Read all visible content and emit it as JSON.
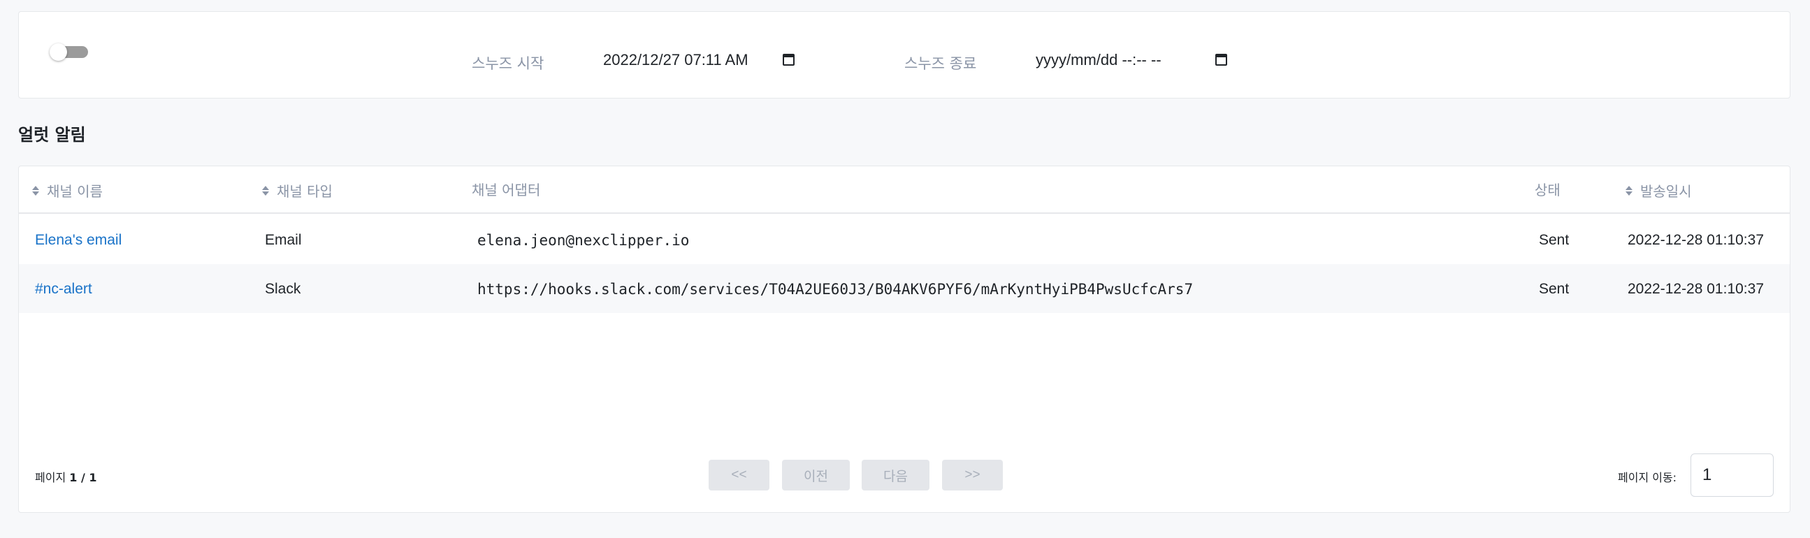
{
  "snooze": {
    "toggle_on": false,
    "start_label": "스누즈 시작",
    "start_value": "2022/12/27 07:11 AM",
    "end_label": "스누즈 종료",
    "end_value": "yyyy/mm/dd --:-- --"
  },
  "section": {
    "title": "얼럿 알림"
  },
  "table": {
    "headers": {
      "channel_name": "채널 이름",
      "channel_type": "채널 타입",
      "channel_adapter": "채널 어댑터",
      "status": "상태",
      "sent_at": "발송일시"
    },
    "rows": [
      {
        "name": "Elena's email",
        "type": "Email",
        "adapter": "elena.jeon@nexclipper.io",
        "status": "Sent",
        "sent_at": "2022-12-28 01:10:37"
      },
      {
        "name": "#nc-alert",
        "type": "Slack",
        "adapter": "https://hooks.slack.com/services/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",
        "status": "Sent",
        "sent_at": "2022-12-28 01:10:37"
      }
    ]
  },
  "pagination": {
    "page_label": "페이지",
    "page_value": "1 / 1",
    "first": "<<",
    "prev": "이전",
    "next": "다음",
    "last": ">>",
    "goto_label": "페이지 이동:",
    "goto_value": "1"
  },
  "colors": {
    "link": "#1a73c8",
    "muted": "#8a94a6",
    "toggle_track": "#9b9b9b",
    "button_bg": "#e4e6ea"
  }
}
